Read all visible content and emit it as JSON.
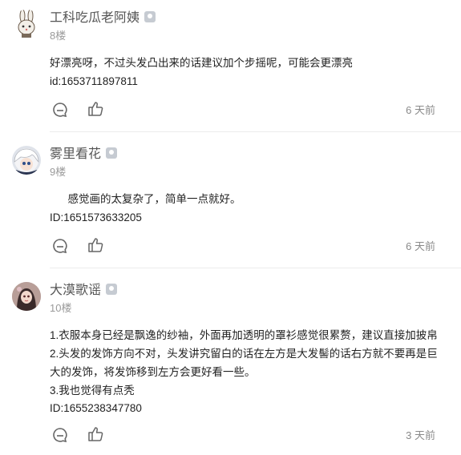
{
  "comments": [
    {
      "user": "工科吃瓜老阿姨",
      "floor": "8楼",
      "lines": [
        "好漂亮呀，不过头发凸出来的话建议加个步摇呢，可能会更漂亮",
        "id:1653711897811"
      ],
      "time": "6 天前",
      "avatar": "bunny-avatar"
    },
    {
      "user": "雾里看花",
      "floor": "9楼",
      "lines": [
        "      感觉画的太复杂了，简单一点就好。",
        "ID:1651573633205"
      ],
      "time": "6 天前",
      "avatar": "white-hair-girl-avatar"
    },
    {
      "user": "大漠歌谣",
      "floor": "10楼",
      "lines": [
        "1.衣服本身已经是飘逸的纱袖，外面再加透明的罩衫感觉很累赘，建议直接加披帛",
        "2.头发的发饰方向不对，头发讲究留白的话在左方是大发髻的话右方就不要再是巨",
        "大的发饰，将发饰移到左方会更好看一些。",
        "3.我也觉得有点秃",
        "ID:1655238347780"
      ],
      "time": "3 天前",
      "avatar": "dark-hair-girl-avatar"
    }
  ],
  "icons": {
    "reply": "comment-bubble-icon",
    "like": "thumbs-up-icon",
    "level": "level-badge-icon"
  },
  "colors": {
    "username": "#555555",
    "meta": "#9a9a9a",
    "text": "#222222",
    "divider": "#ececec"
  }
}
